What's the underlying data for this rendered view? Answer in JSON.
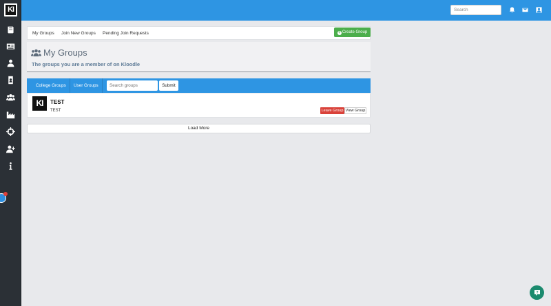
{
  "brand": {
    "logo_text": "KI"
  },
  "sidebar": {
    "items": [
      {
        "icon": "book-icon"
      },
      {
        "icon": "newspaper-icon"
      },
      {
        "icon": "user-icon"
      },
      {
        "icon": "id-badge-icon"
      },
      {
        "icon": "users-icon"
      },
      {
        "icon": "industry-icon"
      },
      {
        "icon": "crosshairs-icon"
      },
      {
        "icon": "user-plus-icon"
      },
      {
        "icon": "info-icon"
      }
    ]
  },
  "topbar": {
    "search_placeholder": "Search",
    "icons": [
      "bell-icon",
      "envelope-icon",
      "profile-icon"
    ]
  },
  "tabs": {
    "items": [
      "My Groups",
      "Join New Groups",
      "Pending Join Requests"
    ],
    "create_button": "Create Group"
  },
  "header": {
    "title": "My Groups",
    "subtitle": "The groups you are a member of on Kloodle"
  },
  "filter": {
    "tabs": [
      "College Groups",
      "User Groups"
    ],
    "search_placeholder": "Search groups",
    "submit_label": "Submit"
  },
  "groups": [
    {
      "logo_text": "KI",
      "name": "TEST",
      "description": "TEST",
      "leave_label": "Leave Group",
      "view_label": "View Group"
    }
  ],
  "load_more_label": "Load More",
  "colors": {
    "primary_blue": "#2e95e3",
    "sidebar_bg": "#2b3036",
    "create_green": "#4cae4c",
    "leave_red": "#d9423a",
    "help_green": "#1b8a6e"
  }
}
